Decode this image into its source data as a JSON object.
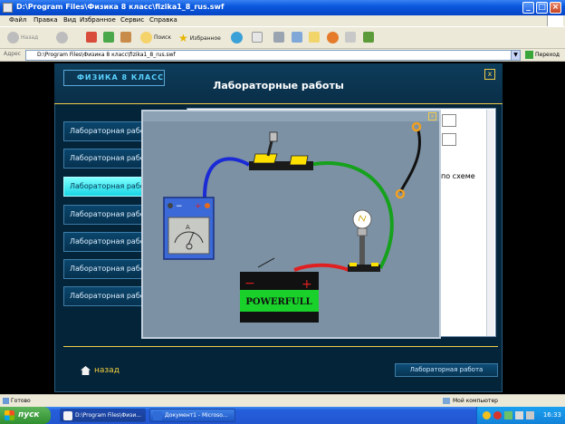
{
  "window": {
    "title": "D:\\Program Files\\Физика 8 класс\\fizika1_8_rus.swf"
  },
  "menu": [
    "Файл",
    "Правка",
    "Вид",
    "Избранное",
    "Сервис",
    "Справка"
  ],
  "toolbar": {
    "back_label": "Назад",
    "search_label": "Поиск",
    "favorites_label": "Избранное"
  },
  "address": {
    "label": "Адрес",
    "value": "D:\\Program Files\\Физика 8 класс\\fizika1_8_rus.swf",
    "go_label": "Переход"
  },
  "app": {
    "logo_text": "ФИЗИКА 8 КЛАСС",
    "title": "Лабораторные работы",
    "close_label": "x",
    "sidebar": [
      {
        "label": "Лабораторная работа",
        "active": false
      },
      {
        "label": "Лабораторная работа",
        "active": false
      },
      {
        "label": "Лабораторная работа",
        "active": true
      },
      {
        "label": "Лабораторная работа",
        "active": false
      },
      {
        "label": "Лабораторная работа",
        "active": false
      },
      {
        "label": "Лабораторная работа",
        "active": false
      },
      {
        "label": "Лабораторная работа",
        "active": false
      }
    ],
    "panel_text": "по схеме",
    "modal_close_label": "x",
    "battery_label": "POWERFULL",
    "battery_minus": "−",
    "battery_plus": "+",
    "ammeter_minus": "−",
    "ammeter_plus": "+",
    "ammeter_unit": "A",
    "back_label": "назад",
    "footer_button": "Лабораторная работа"
  },
  "status": {
    "text": "Готово",
    "zone": "Мой компьютер"
  },
  "taskbar": {
    "start_label": "пуск",
    "tasks": [
      {
        "label": "D:\\Program Files\\Физи...",
        "active": true
      },
      {
        "label": "Документ1 - Microso...",
        "active": false
      }
    ],
    "clock": "16:33"
  },
  "colors": {
    "accent": "#f3cc4a",
    "active_tab": "#19d6e6",
    "wire_blue": "#1a2bd6",
    "wire_green": "#16a11c",
    "wire_red": "#e02020",
    "wire_black": "#111111"
  }
}
